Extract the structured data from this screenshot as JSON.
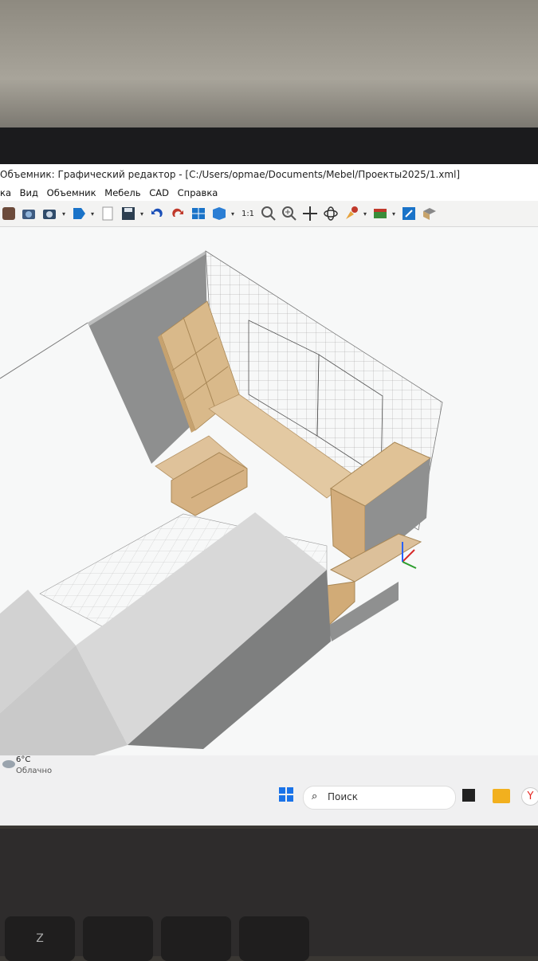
{
  "window": {
    "title": "Объемник: Графический редактор - [C:/Users/орmae/Documents/Mebel/Проекты2025/1.xml]"
  },
  "menu": [
    "ка",
    "Вид",
    "Объемник",
    "Мебель",
    "CAD",
    "Справка"
  ],
  "toolbar": {
    "icons": [
      "cube-icon",
      "camera-icon",
      "camera-multi-icon",
      "shape-icon",
      "new-file-icon",
      "save-icon",
      "undo-icon",
      "redo-icon",
      "view-grid-icon",
      "cube-blue-icon",
      "zoom-1to1-icon",
      "zoom-icon",
      "zoom-plus-icon",
      "pan-icon",
      "rotate-icon",
      "paint-icon",
      "ruler-icon",
      "export-icon",
      "library-icon"
    ],
    "zoom_label": "1:1"
  },
  "weather": {
    "temperature": "6°C",
    "condition": "Облачно"
  },
  "taskbar": {
    "search_placeholder": "Поиск"
  },
  "keyboard": {
    "keys": [
      "Z",
      "",
      "",
      ""
    ]
  },
  "colors": {
    "wood": "#d9b98a",
    "wall_gray": "#8e8f8f",
    "grid": "#8c8c8c",
    "accent_blue": "#1a73c8"
  }
}
